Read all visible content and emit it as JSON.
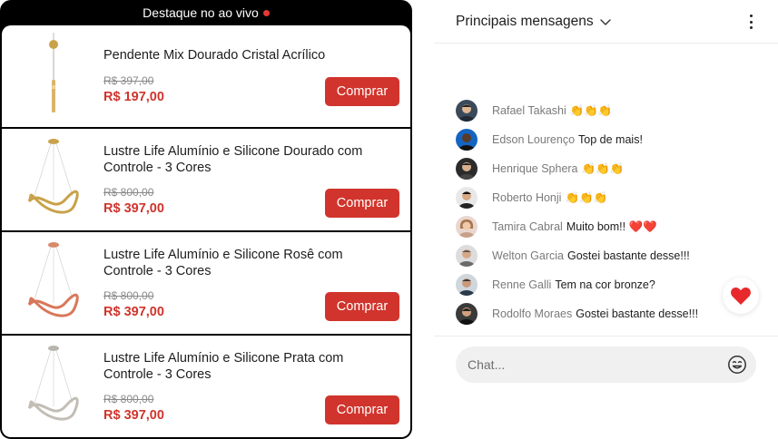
{
  "products_panel": {
    "title": "Destaque no ao vivo",
    "items": [
      {
        "name": "Pendente Mix Dourado Cristal Acrílico",
        "old_price": "R$ 397,00",
        "price": "R$ 197,00",
        "button": "Comprar",
        "thumb": "pendant-gold-icon"
      },
      {
        "name": "Lustre Life Alumínio e Silicone Dourado com Controle - 3 Cores",
        "old_price": "R$ 800,00",
        "price": "R$ 397,00",
        "button": "Comprar",
        "thumb": "chandelier-gold-icon"
      },
      {
        "name": "Lustre Life Alumínio e Silicone Rosê com Controle - 3 Cores",
        "old_price": "R$ 800,00",
        "price": "R$ 397,00",
        "button": "Comprar",
        "thumb": "chandelier-rose-icon"
      },
      {
        "name": "Lustre Life Alumínio e Silicone Prata com Controle - 3 Cores",
        "old_price": "R$ 800,00",
        "price": "R$ 397,00",
        "button": "Comprar",
        "thumb": "chandelier-silver-icon"
      }
    ]
  },
  "chat": {
    "title": "Principais mensagens",
    "messages": [
      {
        "user": "Rafael Takashi",
        "text": "👏👏👏"
      },
      {
        "user": "Edson Lourenço",
        "text": "Top de mais!"
      },
      {
        "user": "Henrique Sphera",
        "text": "👏👏👏"
      },
      {
        "user": "Roberto Honji",
        "text": "👏👏👏"
      },
      {
        "user": "Tamira Cabral",
        "text": "Muito bom!! ❤️❤️"
      },
      {
        "user": "Welton Garcia",
        "text": "Gostei bastante desse!!!"
      },
      {
        "user": "Renne Galli",
        "text": "Tem na cor bronze?"
      },
      {
        "user": "Rodolfo Moraes",
        "text": "Gostei bastante desse!!!"
      }
    ],
    "input_placeholder": "Chat...",
    "reaction_icon": "heart-icon",
    "emoji_icon": "smiley-icon"
  },
  "colors": {
    "accent": "#d0342c",
    "live_dot": "#e53935",
    "panel_border": "#000000"
  }
}
